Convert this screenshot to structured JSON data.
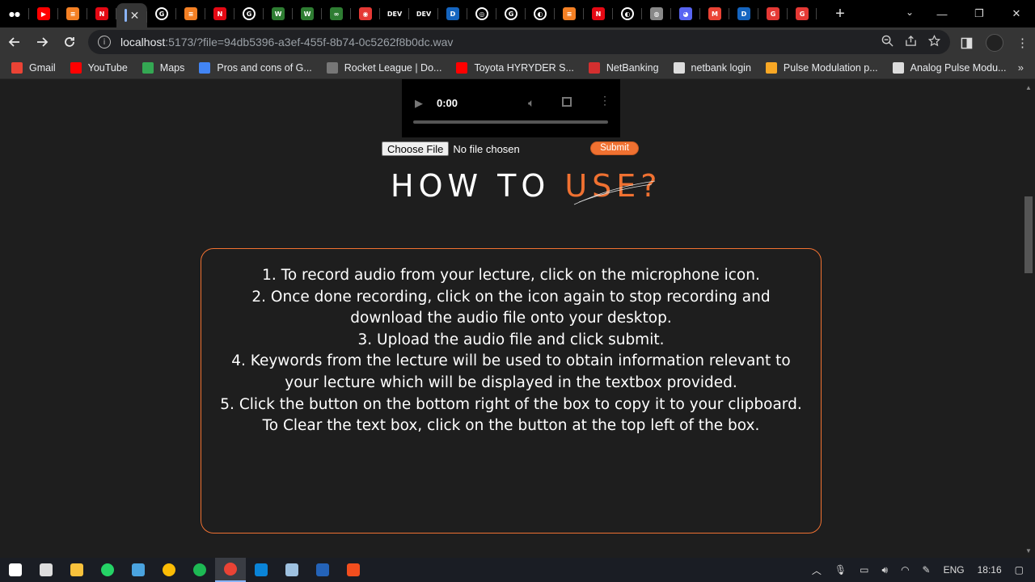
{
  "browser": {
    "tabs": [
      {
        "icon": "medium-icon",
        "color": "#000000",
        "glyph": "●●"
      },
      {
        "icon": "youtube-icon",
        "color": "#ff0000",
        "glyph": "▶"
      },
      {
        "icon": "stackoverflow-icon",
        "color": "#f48024",
        "glyph": "≡"
      },
      {
        "icon": "netflix-icon",
        "color": "#e50914",
        "glyph": "N"
      },
      {
        "icon": "active-tab-icon",
        "color": "#353535",
        "glyph": "",
        "active": true
      },
      {
        "icon": "google-icon",
        "color": "#ffffff",
        "glyph": "G"
      },
      {
        "icon": "stackoverflow-icon",
        "color": "#f48024",
        "glyph": "≡"
      },
      {
        "icon": "netflix-icon",
        "color": "#e50914",
        "glyph": "N"
      },
      {
        "icon": "google-icon",
        "color": "#ffffff",
        "glyph": "G"
      },
      {
        "icon": "wordpress-w-icon",
        "color": "#2e7d32",
        "glyph": "W"
      },
      {
        "icon": "wordpress-w-icon",
        "color": "#2e7d32",
        "glyph": "W"
      },
      {
        "icon": "link-icon",
        "color": "#2e7d32",
        "glyph": "∞"
      },
      {
        "icon": "record-icon",
        "color": "#e53935",
        "glyph": "◉"
      },
      {
        "icon": "dev-icon",
        "color": "#000000",
        "glyph": "DEV"
      },
      {
        "icon": "dev-icon",
        "color": "#000000",
        "glyph": "DEV"
      },
      {
        "icon": "d-icon",
        "color": "#1565c0",
        "glyph": "D"
      },
      {
        "icon": "chrome-icon",
        "color": "#ffffff",
        "glyph": "◎"
      },
      {
        "icon": "google-icon",
        "color": "#ffffff",
        "glyph": "G"
      },
      {
        "icon": "github-icon",
        "color": "#ffffff",
        "glyph": "◐"
      },
      {
        "icon": "stackoverflow-icon",
        "color": "#f48024",
        "glyph": "≡"
      },
      {
        "icon": "netflix-icon",
        "color": "#e50914",
        "glyph": "N"
      },
      {
        "icon": "github-icon",
        "color": "#ffffff",
        "glyph": "◐"
      },
      {
        "icon": "globe-icon",
        "color": "#888888",
        "glyph": "◍"
      },
      {
        "icon": "discord-icon",
        "color": "#5865f2",
        "glyph": "◕"
      },
      {
        "icon": "gmail-icon",
        "color": "#ea4335",
        "glyph": "M"
      },
      {
        "icon": "d-icon",
        "color": "#1565c0",
        "glyph": "D"
      },
      {
        "icon": "g-red-icon",
        "color": "#e53935",
        "glyph": "G"
      },
      {
        "icon": "g-red-icon",
        "color": "#e53935",
        "glyph": "G"
      }
    ],
    "url_host": "localhost",
    "url_rest": ":5173/?file=94db5396-a3ef-455f-8b74-0c5262f8b0dc.wav",
    "bookmarks": [
      {
        "label": "Gmail",
        "icon": "gmail-icon",
        "color": "#ea4335"
      },
      {
        "label": "YouTube",
        "icon": "youtube-icon",
        "color": "#ff0000"
      },
      {
        "label": "Maps",
        "icon": "maps-icon",
        "color": "#34a853"
      },
      {
        "label": "Pros and cons of G...",
        "icon": "pros-cons-icon",
        "color": "#4285f4"
      },
      {
        "label": "Rocket League | Do...",
        "icon": "rocket-league-icon",
        "color": "#777777"
      },
      {
        "label": "Toyota HYRYDER S...",
        "icon": "youtube-icon",
        "color": "#ff0000"
      },
      {
        "label": "NetBanking",
        "icon": "bank-icon",
        "color": "#d32f2f"
      },
      {
        "label": "netbank login",
        "icon": "globe-icon",
        "color": "#dddddd"
      },
      {
        "label": "Pulse Modulation p...",
        "icon": "pulse-icon",
        "color": "#f9a825"
      },
      {
        "label": "Analog Pulse Modu...",
        "icon": "globe-icon",
        "color": "#dddddd"
      }
    ]
  },
  "page": {
    "audio_time": "0:00",
    "choose_file_label": "Choose File",
    "no_file_text": "No file chosen",
    "submit_label": "Submit",
    "heading_white": "HOW TO ",
    "heading_orange": "USE?",
    "instructions": [
      "1. To record audio from your lecture, click on the microphone icon.",
      "2. Once done recording, click on the icon again to stop recording and download the audio file onto your desktop.",
      "3. Upload the audio file and click submit.",
      "4. Keywords from the lecture will be used to obtain information relevant to your lecture which will be displayed in the textbox provided.",
      "5. Click the button on the bottom right of the box to copy it to your clipboard. To Clear the text box, click on the button at the top left of the box."
    ],
    "accent_color": "#f07131"
  },
  "taskbar": {
    "apps": [
      {
        "icon": "windows-start-icon",
        "color": "#ffffff"
      },
      {
        "icon": "task-view-icon",
        "color": "#dddddd"
      },
      {
        "icon": "file-explorer-icon",
        "color": "#f9c23c"
      },
      {
        "icon": "whatsapp-icon",
        "color": "#25d366"
      },
      {
        "icon": "app-icon",
        "color": "#4aa3df"
      },
      {
        "icon": "chrome-icon",
        "color": "#fbbc05"
      },
      {
        "icon": "spotify-icon",
        "color": "#1db954"
      },
      {
        "icon": "chrome-active-icon",
        "color": "#ea4335",
        "active": true
      },
      {
        "icon": "vscode-icon",
        "color": "#0a84d8"
      },
      {
        "icon": "app-icon",
        "color": "#9ec1e0"
      },
      {
        "icon": "powershell-icon",
        "color": "#2463b8"
      },
      {
        "icon": "figma-icon",
        "color": "#f24e1e"
      }
    ],
    "language": "ENG",
    "time": "18:16"
  }
}
